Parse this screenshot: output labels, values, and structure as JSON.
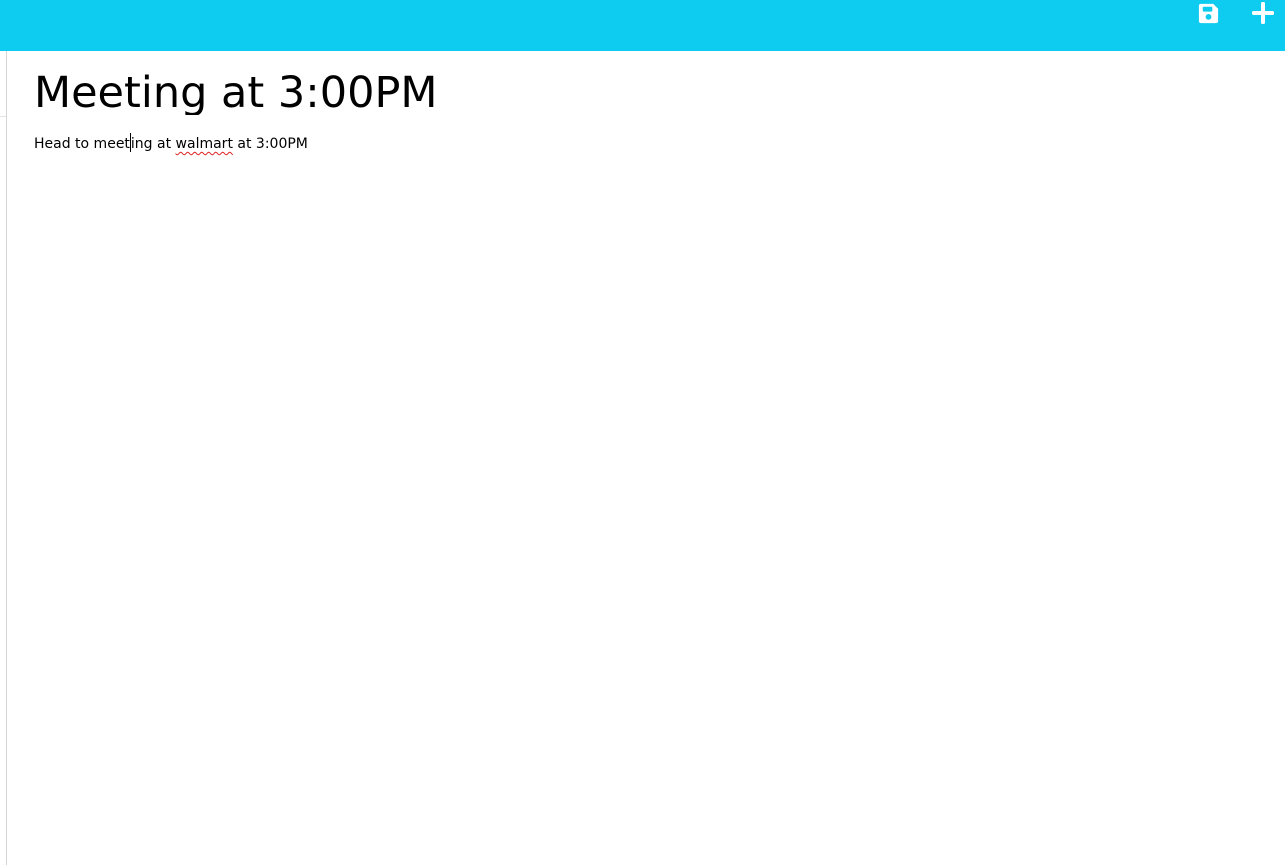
{
  "toolbar": {
    "background_color": "#0ecbf0",
    "icon_color": "#ffffff",
    "save_icon": "floppy-disk-icon",
    "add_icon": "plus-icon"
  },
  "note": {
    "title": "Meeting at 3:00PM",
    "body_part_1": "Head to meet",
    "body_part_2": "ing at ",
    "body_misspelled_word": "walmart",
    "body_part_3": " at 3:00PM",
    "misspelling_underline_color": "#e02020"
  }
}
